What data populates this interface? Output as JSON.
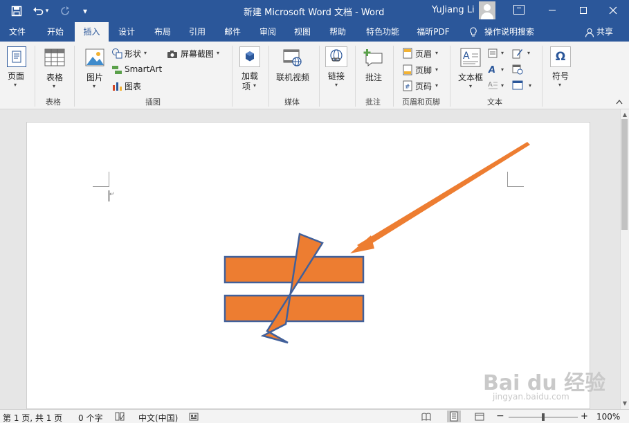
{
  "titlebar": {
    "title": "新建 Microsoft Word 文档  -  Word",
    "user": "YuJiang Li",
    "colors": {
      "accent": "#2b579a"
    }
  },
  "tabs": [
    {
      "label": "文件"
    },
    {
      "label": "开始"
    },
    {
      "label": "插入",
      "active": true
    },
    {
      "label": "设计"
    },
    {
      "label": "布局"
    },
    {
      "label": "引用"
    },
    {
      "label": "邮件"
    },
    {
      "label": "审阅"
    },
    {
      "label": "视图"
    },
    {
      "label": "帮助"
    },
    {
      "label": "特色功能"
    },
    {
      "label": "福昕PDF"
    }
  ],
  "tell_me": "操作说明搜索",
  "share": "共享",
  "ribbon": {
    "page": "页面",
    "table": "表格",
    "group_table": "表格",
    "picture": "图片",
    "shapes": "形状",
    "smartart": "SmartArt",
    "chart": "图表",
    "screenshot": "屏幕截图",
    "group_illustrations": "插图",
    "addins_1": "加载",
    "addins_2": "项",
    "online_video": "联机视频",
    "group_media": "媒体",
    "link": "链接",
    "comment": "批注",
    "group_comments": "批注",
    "header": "页眉",
    "footer": "页脚",
    "page_number": "页码",
    "group_header_footer": "页眉和页脚",
    "textbox": "文本框",
    "group_text": "文本",
    "symbol": "符号",
    "omega": "Ω"
  },
  "document": {
    "shape_color": "#ed7d31",
    "shape_border": "#41609a",
    "arrow_color": "#ed7d31",
    "para_mark": "↵"
  },
  "statusbar": {
    "page_info": "第 1 页, 共 1 页",
    "word_count": "0 个字",
    "language": "中文(中国)",
    "zoom_minus": "−",
    "zoom_plus": "+",
    "zoom": "100%"
  },
  "watermark": {
    "brand": "Bai du 经验",
    "url": "jingyan.baidu.com"
  }
}
